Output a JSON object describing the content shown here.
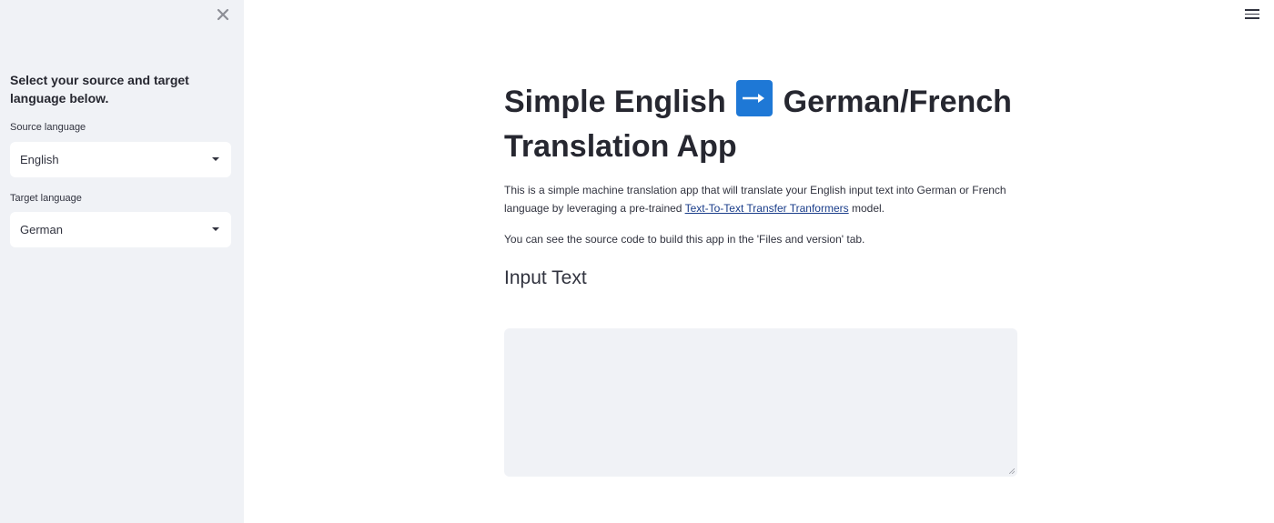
{
  "sidebar": {
    "heading": "Select your source and target language below.",
    "source": {
      "label": "Source language",
      "value": "English"
    },
    "target": {
      "label": "Target language",
      "value": "German"
    }
  },
  "main": {
    "title_part1": "Simple English",
    "title_part2": "German/French Translation App",
    "intro_text_before_link": "This is a simple machine translation app that will translate your English input text into German or French language by leveraging a pre-trained ",
    "intro_link": "Text-To-Text Transfer Tranformers",
    "intro_text_after_link": " model.",
    "source_note": "You can see the source code to build this app in the 'Files and version' tab.",
    "input_heading": "Input Text",
    "input_value": ""
  },
  "colors": {
    "sidebar_bg": "#f0f2f6",
    "accent_emoji": "#1e78d6",
    "link": "#1a3d8a"
  },
  "icons": {
    "close": "close-icon",
    "menu": "hamburger-menu-icon",
    "arrow": "right-arrow-emoji-icon",
    "caret": "chevron-down-icon"
  }
}
